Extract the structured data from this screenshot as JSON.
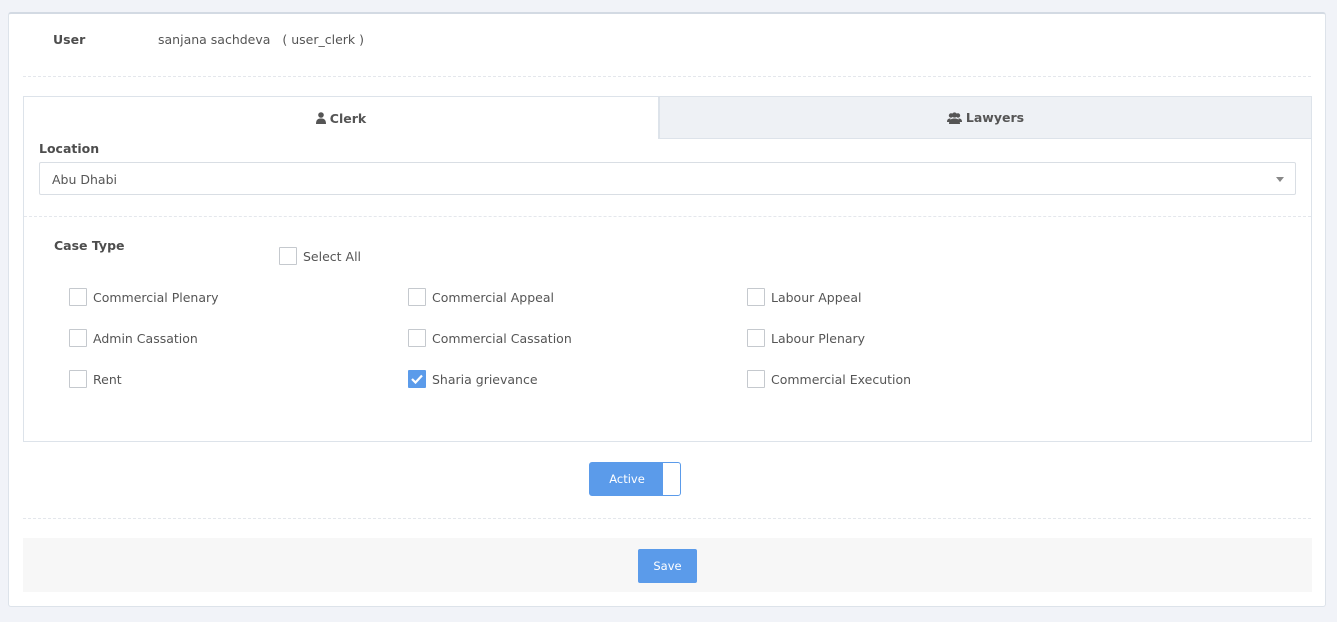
{
  "user": {
    "label": "User",
    "value": "sanjana sachdeva   ( user_clerk )"
  },
  "tabs": [
    {
      "label": "Clerk",
      "icon": "user-icon",
      "active": true
    },
    {
      "label": "Lawyers",
      "icon": "users-icon",
      "active": false
    }
  ],
  "location": {
    "label": "Location",
    "selected": "Abu Dhabi"
  },
  "case_type": {
    "label": "Case Type",
    "select_all": {
      "label": "Select All",
      "checked": false
    },
    "items": [
      {
        "label": "Commercial Plenary",
        "checked": false
      },
      {
        "label": "Commercial Appeal",
        "checked": false
      },
      {
        "label": "Labour Appeal",
        "checked": false
      },
      {
        "label": "Admin Cassation",
        "checked": false
      },
      {
        "label": "Commercial Cassation",
        "checked": false
      },
      {
        "label": "Labour Plenary",
        "checked": false
      },
      {
        "label": "Rent",
        "checked": false
      },
      {
        "label": "Sharia grievance",
        "checked": true
      },
      {
        "label": "Commercial Execution",
        "checked": false
      }
    ]
  },
  "status_toggle": {
    "label": "Active",
    "on": true
  },
  "save_label": "Save",
  "colors": {
    "accent": "#5b9bea",
    "tab_inactive_bg": "#eef1f5",
    "footer_bg": "#f7f7f7"
  }
}
